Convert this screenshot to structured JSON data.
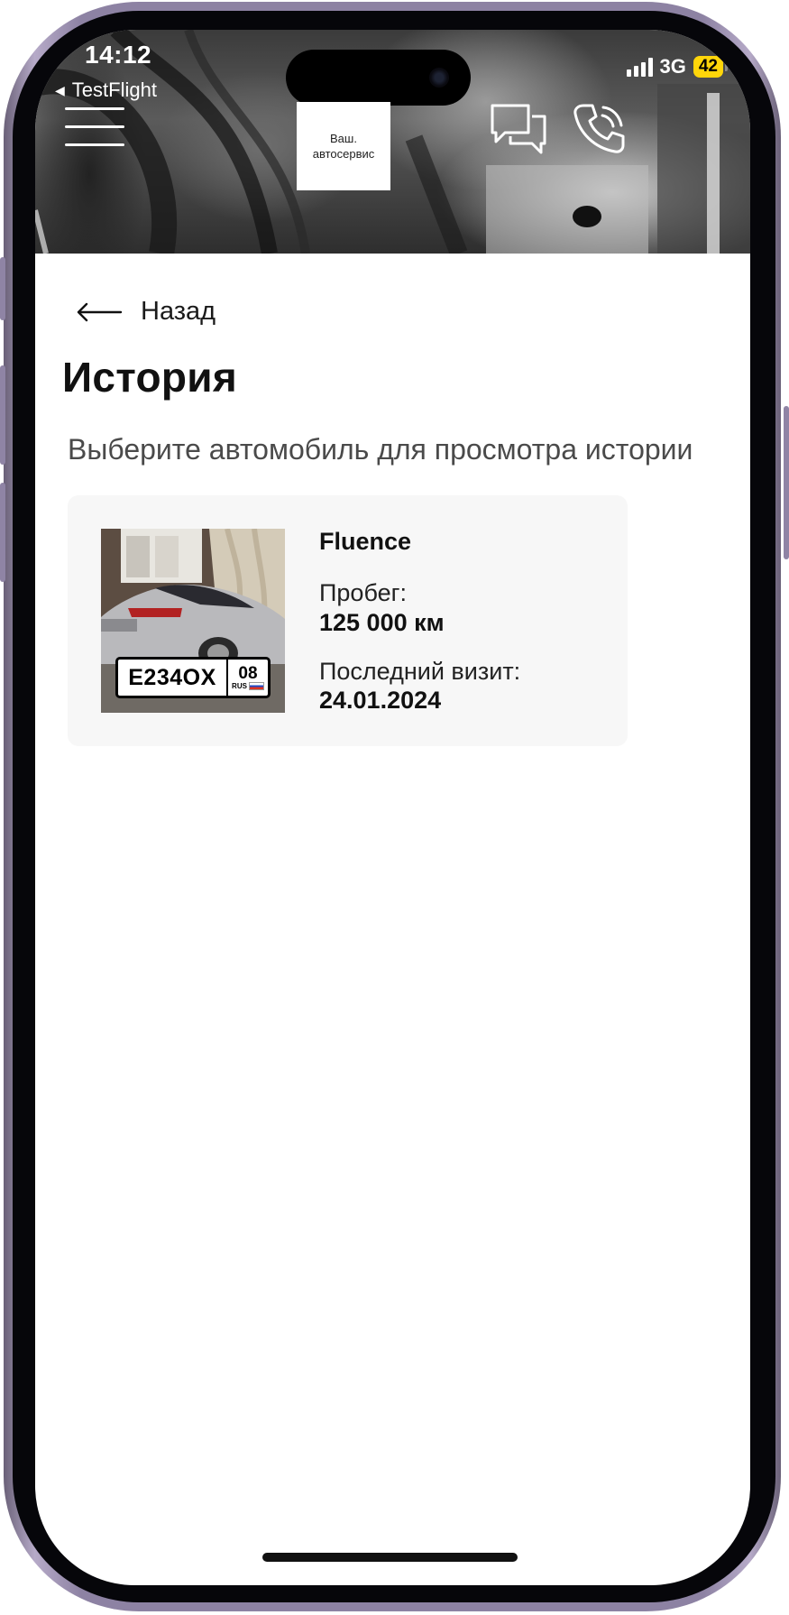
{
  "status_bar": {
    "time": "14:12",
    "back_app": "TestFlight",
    "network": "3G",
    "battery": "42"
  },
  "header": {
    "logo_line1": "Ваш.",
    "logo_line2": "автосервис"
  },
  "nav": {
    "back_label": "Назад"
  },
  "page": {
    "title": "История",
    "subtitle": "Выберите автомобиль для просмотра истории"
  },
  "vehicles": [
    {
      "name": "Fluence",
      "plate_number": "E234OX",
      "plate_region": "08",
      "plate_country": "RUS",
      "mileage_label": "Пробег:",
      "mileage_value": "125 000 км",
      "last_visit_label": "Последний визит:",
      "last_visit_value": "24.01.2024"
    }
  ],
  "colors": {
    "battery_badge": "#ffd60a",
    "card_background": "#f7f7f7",
    "frame": "#8d82a3"
  }
}
